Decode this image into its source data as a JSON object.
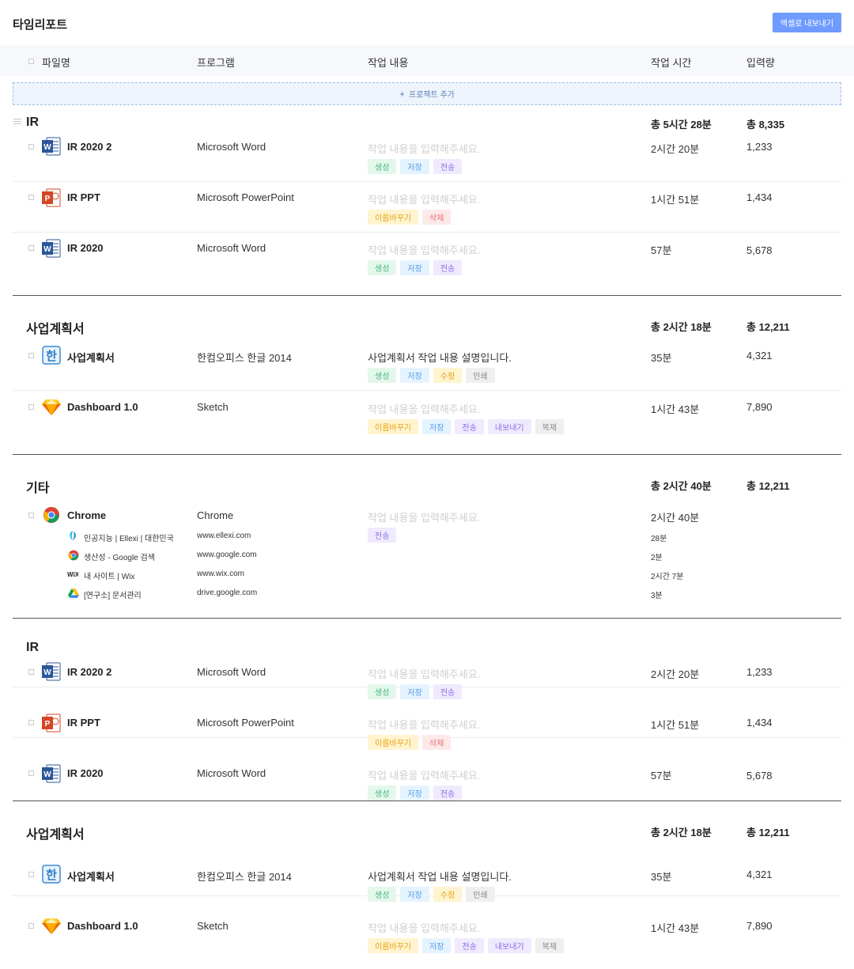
{
  "page": {
    "title": "타임리포트",
    "export_button": "엑셀로 내보내기"
  },
  "columns": {
    "file": "파일명",
    "program": "프로그램",
    "content": "작업 내용",
    "time": "작업 시간",
    "input": "입력량"
  },
  "add_project": "프로젝트 추가",
  "placeholder": "작업 내용을 입력해주세요.",
  "groups": [
    {
      "name": "IR",
      "time": "총 5시간 28분",
      "input": "총 8,335",
      "rows": [
        {
          "file": "IR 2020 2",
          "program": "Microsoft Word",
          "time": "2시간 20분",
          "input": "1,233",
          "tags": [
            "생성",
            "저장",
            "전송"
          ]
        },
        {
          "file": "IR PPT",
          "program": "Microsoft PowerPoint",
          "time": "1시간 51분",
          "input": "1,434",
          "tags": [
            "이름바꾸기",
            "삭제"
          ]
        },
        {
          "file": "IR 2020",
          "program": "Microsoft Word",
          "time": "57분",
          "input": "5,678",
          "tags": [
            "생성",
            "저장",
            "전송"
          ]
        }
      ]
    },
    {
      "name": "사업계획서",
      "time": "총 2시간 18분",
      "input": "총 12,211",
      "rows": [
        {
          "file": "사업계획서",
          "program": "한컴오피스 한글 2014",
          "desc": "사업계획서 작업 내용 설명입니다.",
          "time": "35분",
          "input": "4,321",
          "tags": [
            "생성",
            "저장",
            "수정",
            "인쇄"
          ]
        },
        {
          "file": "Dashboard 1.0",
          "program": "Sketch",
          "time": "1시간 43분",
          "input": "7,890",
          "tags": [
            "이름바꾸기",
            "저장",
            "전송",
            "내보내기",
            "복제"
          ]
        }
      ]
    },
    {
      "name": "기타",
      "time": "총 2시간 40분",
      "input": "총 12,211",
      "rows": [
        {
          "file": "Chrome",
          "program": "Chrome",
          "time": "2시간 40분",
          "tags": [
            "전송"
          ],
          "subs": [
            {
              "title": "인공지능 | Ellexi | 대한민국",
              "url": "www.ellexi.com",
              "time": "28분"
            },
            {
              "title": "생산성 - Google 검색",
              "url": "www.google.com",
              "time": "2분"
            },
            {
              "title": "내 사이트 | Wix",
              "url": "www.wix.com",
              "time": "2시간 7분"
            },
            {
              "title": "[연구소] 문서관리",
              "url": "drive.google.com",
              "time": "3분"
            }
          ]
        }
      ]
    },
    {
      "name": "IR",
      "rows": [
        {
          "file": "IR 2020 2",
          "program": "Microsoft Word",
          "time": "2시간 20분",
          "input": "1,233",
          "tags": [
            "생성",
            "저장",
            "전송"
          ]
        },
        {
          "file": "IR PPT",
          "program": "Microsoft PowerPoint",
          "time": "1시간 51분",
          "input": "1,434",
          "tags": [
            "이름바꾸기",
            "삭제"
          ]
        },
        {
          "file": "IR 2020",
          "program": "Microsoft Word",
          "time": "57분",
          "input": "5,678",
          "tags": [
            "생성",
            "저장",
            "전송"
          ]
        }
      ]
    },
    {
      "name": "사업계획서",
      "time": "총 2시간 18분",
      "input": "총 12,211",
      "rows": [
        {
          "file": "사업계획서",
          "program": "한컴오피스 한글 2014",
          "desc": "사업계획서 작업 내용 설명입니다.",
          "time": "35분",
          "input": "4,321",
          "tags": [
            "생성",
            "저장",
            "수정",
            "인쇄"
          ]
        },
        {
          "file": "Dashboard 1.0",
          "program": "Sketch",
          "time": "1시간 43분",
          "input": "7,890",
          "tags": [
            "이름바꾸기",
            "저장",
            "전송",
            "내보내기",
            "복제"
          ]
        }
      ]
    }
  ]
}
